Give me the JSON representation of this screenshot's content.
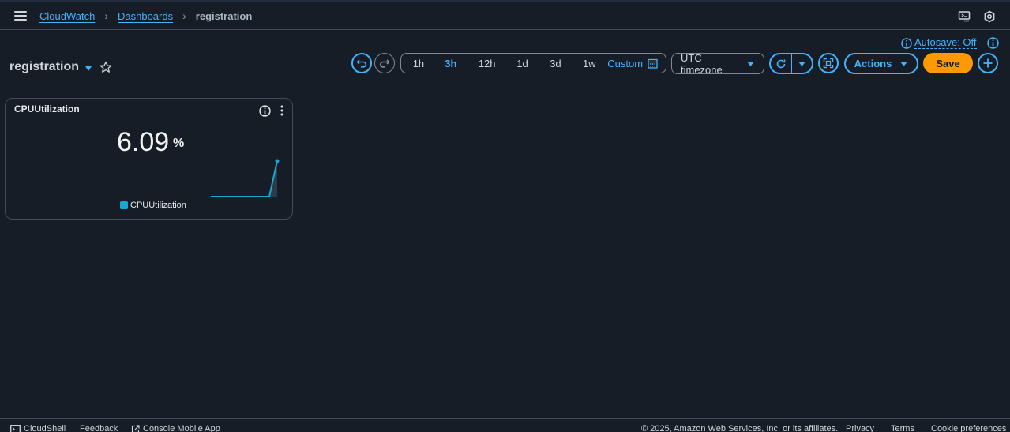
{
  "header": {
    "breadcrumbs": [
      {
        "label": "CloudWatch"
      },
      {
        "label": "Dashboards"
      },
      {
        "label": "registration"
      }
    ]
  },
  "dashboard": {
    "title": "registration",
    "autosave_label": "Autosave: Off"
  },
  "toolbar": {
    "time_ranges": [
      "1h",
      "3h",
      "12h",
      "1d",
      "3d",
      "1w"
    ],
    "active_range": "3h",
    "custom_label": "Custom",
    "timezone_label": "UTC timezone",
    "actions_label": "Actions",
    "save_label": "Save"
  },
  "widget": {
    "title": "CPUUtilization",
    "value": "6.09",
    "unit": "%",
    "legend_label": "CPUUtilization",
    "series_color": "#1aa7d6"
  },
  "footer": {
    "cloudshell": "CloudShell",
    "feedback": "Feedback",
    "mobile_app": "Console Mobile App",
    "copyright": "© 2025, Amazon Web Services, Inc. or its affiliates.",
    "privacy": "Privacy",
    "terms": "Terms",
    "cookies": "Cookie preferences"
  },
  "colors": {
    "accent": "#42b4ff",
    "primary_button": "#ff9900",
    "background": "#161d26"
  }
}
